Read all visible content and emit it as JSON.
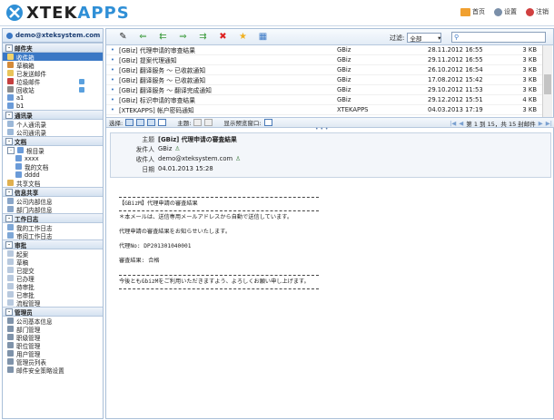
{
  "app": {
    "logo_text_a": "XTEK",
    "logo_text_b": "APPS",
    "top_links": [
      {
        "label": "首页",
        "icon": "home-icon",
        "color": "#f0a030"
      },
      {
        "label": "设置",
        "icon": "settings-icon",
        "color": "#7a8fa9"
      },
      {
        "label": "注销",
        "icon": "logout-icon",
        "color": "#d04040"
      }
    ]
  },
  "sidebar": {
    "account": "demo@xteksystem.com",
    "sections": [
      {
        "title": "邮件夹",
        "items": [
          {
            "label": "收件箱",
            "selected": true
          },
          {
            "label": "草稿箱"
          },
          {
            "label": "已发送邮件"
          },
          {
            "label": "垃圾邮件"
          },
          {
            "label": "回收站"
          },
          {
            "label": "a1"
          },
          {
            "label": "b1"
          }
        ]
      },
      {
        "title": "通讯录",
        "items": [
          {
            "label": "个人通讯录"
          },
          {
            "label": "公司通讯录"
          }
        ]
      },
      {
        "title": "文档",
        "items": [
          {
            "label": "根目录",
            "tree": true
          },
          {
            "label": "xxxx",
            "indent": true
          },
          {
            "label": "我的文档",
            "indent": true
          },
          {
            "label": "dddd",
            "indent": true
          },
          {
            "label": "共享文档"
          }
        ]
      },
      {
        "title": "信息共享",
        "items": [
          {
            "label": "公司内部信息"
          },
          {
            "label": "部门内部信息"
          }
        ]
      },
      {
        "title": "工作日志",
        "items": [
          {
            "label": "我的工作日志"
          },
          {
            "label": "审阅工作日志"
          }
        ]
      },
      {
        "title": "审批",
        "items": [
          {
            "label": "起案"
          },
          {
            "label": "草稿"
          },
          {
            "label": "已提交"
          },
          {
            "label": "已办理"
          },
          {
            "label": "待审批"
          },
          {
            "label": "已审批"
          },
          {
            "label": "流程管理"
          }
        ]
      },
      {
        "title": "管理员",
        "items": [
          {
            "label": "公司基本信息"
          },
          {
            "label": "部门管理"
          },
          {
            "label": "职级管理"
          },
          {
            "label": "职位管理"
          },
          {
            "label": "用户管理"
          },
          {
            "label": "管理员列表"
          },
          {
            "label": "邮件安全策略设置"
          }
        ]
      }
    ]
  },
  "toolbar": {
    "filter_label": "过滤:",
    "filter_value": "全部",
    "search_placeholder": ""
  },
  "messages": [
    {
      "subject": "[GBiz] 代理申请的审查结果",
      "folder": "GBiz",
      "date": "28.11.2012 16:55",
      "size": "3 KB"
    },
    {
      "subject": "[GBiz] 提案代理通知",
      "folder": "GBiz",
      "date": "29.11.2012 16:55",
      "size": "3 KB"
    },
    {
      "subject": "[GBiz] 翻译服务 ～ 已收款通知",
      "folder": "GBiz",
      "date": "26.10.2012 16:54",
      "size": "3 KB"
    },
    {
      "subject": "[GBiz] 翻译服务 ～ 已收款通知",
      "folder": "GBiz",
      "date": "17.08.2012 15:42",
      "size": "3 KB"
    },
    {
      "subject": "[GBiz] 翻译服务 ～ 翻译完成通知",
      "folder": "GBiz",
      "date": "29.10.2012 11:53",
      "size": "3 KB"
    },
    {
      "subject": "[GBiz] 标识申请的审查结果",
      "folder": "GBiz",
      "date": "29.12.2012 15:51",
      "size": "4 KB"
    },
    {
      "subject": "[XTEKAPPS] 帐户密码通知",
      "folder": "XTEKAPPS",
      "date": "04.03.2013 17:19",
      "size": "3 KB"
    }
  ],
  "pager": {
    "select_label": "选择:",
    "theme_label": "主题:",
    "preview_label": "显示预览窗口:",
    "page_info": "第 1 到 15，共 15 封邮件"
  },
  "preview": {
    "subject_label": "主题",
    "subject": "[GBiz] 代理申请の審査結果",
    "from_label": "发件人",
    "from": "GBiz",
    "to_label": "收件人",
    "to": "demo@xteksystem.com",
    "date_label": "日期",
    "date": "04.01.2013 15:28",
    "body": {
      "line1": "【GBizM】代理申請の審査結果",
      "line2": "＊本メールは、送信専用メールアドレスから自動で送信しています。",
      "line3": "代理申請の審査結果をお知らせいたします。",
      "line4": "代理No: DP201301040001",
      "line5": "審査結果: 合格",
      "line6": "今後ともGbizMをご利用いただきますよう、よろしくお願い申し上げます。"
    }
  }
}
